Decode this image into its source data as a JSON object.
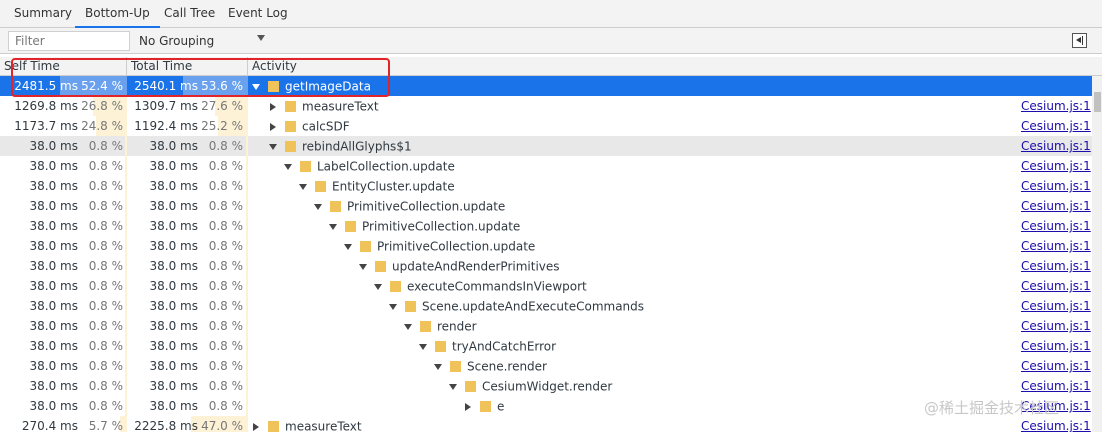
{
  "tabs": [
    {
      "label": "Summary"
    },
    {
      "label": "Bottom-Up",
      "active": true
    },
    {
      "label": "Call Tree"
    },
    {
      "label": "Event Log"
    }
  ],
  "edge": {
    "top": "e",
    "bottom": "t"
  },
  "filter": {
    "placeholder": "Filter"
  },
  "grouping": {
    "value": "No Grouping"
  },
  "columns": {
    "self": "Self Time",
    "total": "Total Time",
    "activity": "Activity"
  },
  "rows": [
    {
      "self_ms": "2481.5 ms",
      "self_pct": "52.4 %",
      "self_frac": 0.524,
      "total_ms": "2540.1 ms",
      "total_pct": "53.6 %",
      "total_frac": 0.536,
      "depth": 0,
      "expand": "down",
      "name": "getImageData",
      "source": "",
      "state": "sel"
    },
    {
      "self_ms": "1269.8 ms",
      "self_pct": "26.8 %",
      "self_frac": 0.268,
      "total_ms": "1309.7 ms",
      "total_pct": "27.6 %",
      "total_frac": 0.276,
      "depth": 1,
      "expand": "right",
      "name": "measureText",
      "source": "Cesium.js:1",
      "state": ""
    },
    {
      "self_ms": "1173.7 ms",
      "self_pct": "24.8 %",
      "self_frac": 0.248,
      "total_ms": "1192.4 ms",
      "total_pct": "25.2 %",
      "total_frac": 0.252,
      "depth": 1,
      "expand": "right",
      "name": "calcSDF",
      "source": "Cesium.js:1",
      "state": ""
    },
    {
      "self_ms": "38.0 ms",
      "self_pct": "0.8 %",
      "self_frac": 0.008,
      "total_ms": "38.0 ms",
      "total_pct": "0.8 %",
      "total_frac": 0.008,
      "depth": 1,
      "expand": "down",
      "name": "rebindAllGlyphs$1",
      "source": "Cesium.js:1",
      "state": "hl"
    },
    {
      "self_ms": "38.0 ms",
      "self_pct": "0.8 %",
      "self_frac": 0.008,
      "total_ms": "38.0 ms",
      "total_pct": "0.8 %",
      "total_frac": 0.008,
      "depth": 2,
      "expand": "down",
      "name": "LabelCollection.update",
      "source": "Cesium.js:1",
      "state": ""
    },
    {
      "self_ms": "38.0 ms",
      "self_pct": "0.8 %",
      "self_frac": 0.008,
      "total_ms": "38.0 ms",
      "total_pct": "0.8 %",
      "total_frac": 0.008,
      "depth": 3,
      "expand": "down",
      "name": "EntityCluster.update",
      "source": "Cesium.js:1",
      "state": ""
    },
    {
      "self_ms": "38.0 ms",
      "self_pct": "0.8 %",
      "self_frac": 0.008,
      "total_ms": "38.0 ms",
      "total_pct": "0.8 %",
      "total_frac": 0.008,
      "depth": 4,
      "expand": "down",
      "name": "PrimitiveCollection.update",
      "source": "Cesium.js:1",
      "state": ""
    },
    {
      "self_ms": "38.0 ms",
      "self_pct": "0.8 %",
      "self_frac": 0.008,
      "total_ms": "38.0 ms",
      "total_pct": "0.8 %",
      "total_frac": 0.008,
      "depth": 5,
      "expand": "down",
      "name": "PrimitiveCollection.update",
      "source": "Cesium.js:1",
      "state": ""
    },
    {
      "self_ms": "38.0 ms",
      "self_pct": "0.8 %",
      "self_frac": 0.008,
      "total_ms": "38.0 ms",
      "total_pct": "0.8 %",
      "total_frac": 0.008,
      "depth": 6,
      "expand": "down",
      "name": "PrimitiveCollection.update",
      "source": "Cesium.js:1",
      "state": ""
    },
    {
      "self_ms": "38.0 ms",
      "self_pct": "0.8 %",
      "self_frac": 0.008,
      "total_ms": "38.0 ms",
      "total_pct": "0.8 %",
      "total_frac": 0.008,
      "depth": 7,
      "expand": "down",
      "name": "updateAndRenderPrimitives",
      "source": "Cesium.js:1",
      "state": ""
    },
    {
      "self_ms": "38.0 ms",
      "self_pct": "0.8 %",
      "self_frac": 0.008,
      "total_ms": "38.0 ms",
      "total_pct": "0.8 %",
      "total_frac": 0.008,
      "depth": 8,
      "expand": "down",
      "name": "executeCommandsInViewport",
      "source": "Cesium.js:1",
      "state": ""
    },
    {
      "self_ms": "38.0 ms",
      "self_pct": "0.8 %",
      "self_frac": 0.008,
      "total_ms": "38.0 ms",
      "total_pct": "0.8 %",
      "total_frac": 0.008,
      "depth": 9,
      "expand": "down",
      "name": "Scene.updateAndExecuteCommands",
      "source": "Cesium.js:1",
      "state": ""
    },
    {
      "self_ms": "38.0 ms",
      "self_pct": "0.8 %",
      "self_frac": 0.008,
      "total_ms": "38.0 ms",
      "total_pct": "0.8 %",
      "total_frac": 0.008,
      "depth": 10,
      "expand": "down",
      "name": "render",
      "source": "Cesium.js:1",
      "state": ""
    },
    {
      "self_ms": "38.0 ms",
      "self_pct": "0.8 %",
      "self_frac": 0.008,
      "total_ms": "38.0 ms",
      "total_pct": "0.8 %",
      "total_frac": 0.008,
      "depth": 11,
      "expand": "down",
      "name": "tryAndCatchError",
      "source": "Cesium.js:1",
      "state": ""
    },
    {
      "self_ms": "38.0 ms",
      "self_pct": "0.8 %",
      "self_frac": 0.008,
      "total_ms": "38.0 ms",
      "total_pct": "0.8 %",
      "total_frac": 0.008,
      "depth": 12,
      "expand": "down",
      "name": "Scene.render",
      "source": "Cesium.js:1",
      "state": ""
    },
    {
      "self_ms": "38.0 ms",
      "self_pct": "0.8 %",
      "self_frac": 0.008,
      "total_ms": "38.0 ms",
      "total_pct": "0.8 %",
      "total_frac": 0.008,
      "depth": 13,
      "expand": "down",
      "name": "CesiumWidget.render",
      "source": "Cesium.js:1",
      "state": ""
    },
    {
      "self_ms": "38.0 ms",
      "self_pct": "0.8 %",
      "self_frac": 0.008,
      "total_ms": "38.0 ms",
      "total_pct": "0.8 %",
      "total_frac": 0.008,
      "depth": 14,
      "expand": "right",
      "name": "e",
      "source": "Cesium.js:1",
      "state": ""
    },
    {
      "self_ms": "270.4 ms",
      "self_pct": "5.7 %",
      "self_frac": 0.057,
      "total_ms": "2225.8 ms",
      "total_pct": "47.0 %",
      "total_frac": 0.47,
      "depth": 0,
      "expand": "right",
      "name": "measureText",
      "source": "Cesium.js:1",
      "state": ""
    }
  ],
  "watermark": "@稀土掘金技术社区"
}
